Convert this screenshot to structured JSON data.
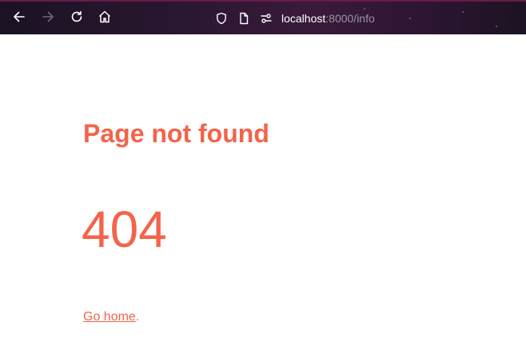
{
  "browser": {
    "address": {
      "host": "localhost",
      "rest": ":8000/info"
    },
    "icons": {
      "back": "arrow-left-icon",
      "forward": "arrow-right-icon",
      "reload": "reload-icon",
      "home": "home-icon",
      "tracking": "shield-icon",
      "page_info": "document-icon",
      "permissions": "permissions-icon"
    },
    "colors": {
      "toolbar_bg": "#2a1730",
      "icon": "#ffffff",
      "icon_disabled": "#6f6878"
    }
  },
  "page": {
    "title": "Page not found",
    "code": "404",
    "home_link": "Go home",
    "home_suffix": ".",
    "accent_color": "#f4634a"
  }
}
